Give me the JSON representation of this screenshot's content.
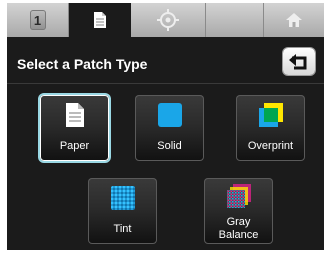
{
  "tabs": [
    {
      "name": "tab-1",
      "number": "1",
      "icon": "number-badge"
    },
    {
      "name": "tab-document",
      "icon": "document-icon",
      "active": true
    },
    {
      "name": "tab-target",
      "icon": "target-icon"
    },
    {
      "name": "tab-blank",
      "icon": ""
    },
    {
      "name": "tab-home",
      "icon": "home-icon"
    }
  ],
  "screen": {
    "title": "Select a Patch Type",
    "back_icon": "back-arrow-icon"
  },
  "patch_types": [
    {
      "label": "Paper",
      "icon": "paper-icon",
      "selected": true
    },
    {
      "label": "Solid",
      "icon": "solid-icon",
      "color": "#1aa6e8"
    },
    {
      "label": "Overprint",
      "icon": "overprint-icon",
      "colors": [
        "#ffe600",
        "#00a651"
      ]
    },
    {
      "label": "Tint",
      "icon": "tint-icon",
      "color": "#1aa6e8"
    },
    {
      "label_line1": "Gray",
      "label_line2": "Balance",
      "icon": "gray-balance-icon"
    }
  ],
  "colors": {
    "screen_bg": "#1b1b1b",
    "selection_glow": "#9ad8e4",
    "cyan": "#1aa6e8",
    "yellow": "#ffe600",
    "green": "#00a651"
  }
}
